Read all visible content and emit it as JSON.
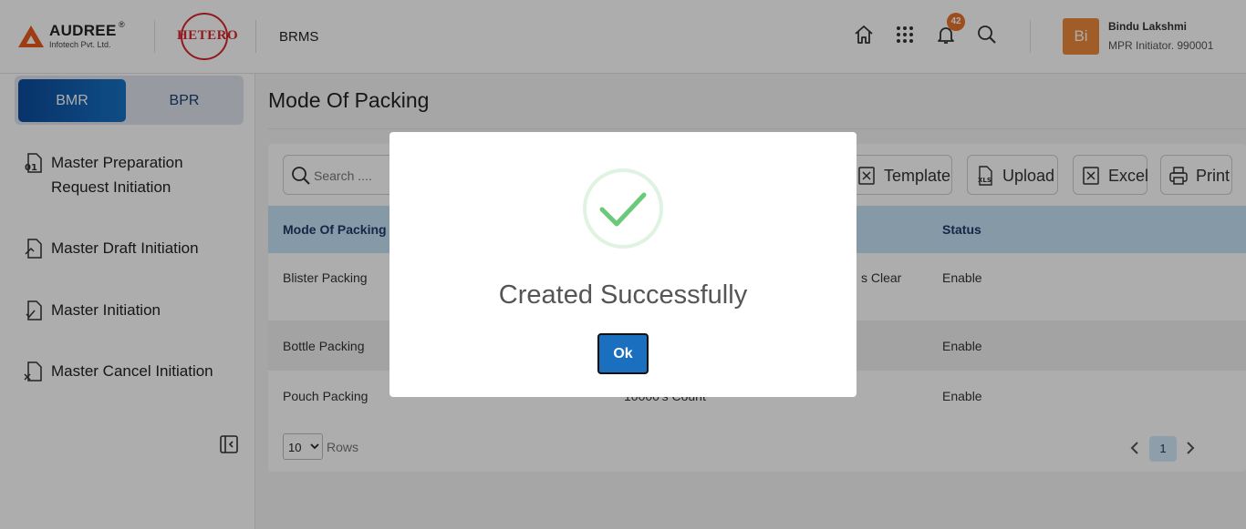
{
  "header": {
    "logo_name": "AUDREE",
    "logo_reg": "®",
    "logo_sub": "Infotech Pvt. Ltd.",
    "partner_logo": "HETERO",
    "app_name": "BRMS",
    "icons": [
      "home-icon",
      "apps-grid-icon",
      "bell-icon",
      "search-icon"
    ],
    "notification_count": "42",
    "user": {
      "initials": "Bi",
      "name": "Bindu Lakshmi",
      "role": "MPR Initiator. 990001"
    }
  },
  "sidebar": {
    "tabs": [
      {
        "label": "BMR",
        "active": true
      },
      {
        "label": "BPR",
        "active": false
      }
    ],
    "items": [
      {
        "label": "Master Preparation Request Initiation",
        "icon": "request-doc-icon"
      },
      {
        "label": "Master Draft Initiation",
        "icon": "draft-doc-icon"
      },
      {
        "label": "Master Initiation",
        "icon": "check-doc-icon"
      },
      {
        "label": "Master Cancel Initiation",
        "icon": "cancel-doc-icon"
      }
    ]
  },
  "main": {
    "title": "Mode Of Packing",
    "search_placeholder": "Search ....",
    "toolbar": {
      "template": "Template",
      "upload": "Upload",
      "excel": "Excel",
      "print": "Print"
    },
    "table": {
      "headers": {
        "mode": "Mode Of Packing",
        "status": "Status"
      },
      "rows": [
        {
          "mode": "Blister Packing",
          "middle": "s Clear",
          "status": "Enable"
        },
        {
          "mode": "Bottle Packing",
          "middle": "",
          "status": "Enable"
        },
        {
          "mode": "Pouch Packing",
          "middle": "10000's Count",
          "status": "Enable"
        }
      ]
    },
    "pagination": {
      "rows_value": "10",
      "rows_label": "Rows",
      "current_page": "1"
    }
  },
  "modal": {
    "title": "Created Successfully",
    "ok_label": "Ok",
    "colors": {
      "check": "#6cc97a",
      "ok_button": "#1a6fbf"
    }
  }
}
